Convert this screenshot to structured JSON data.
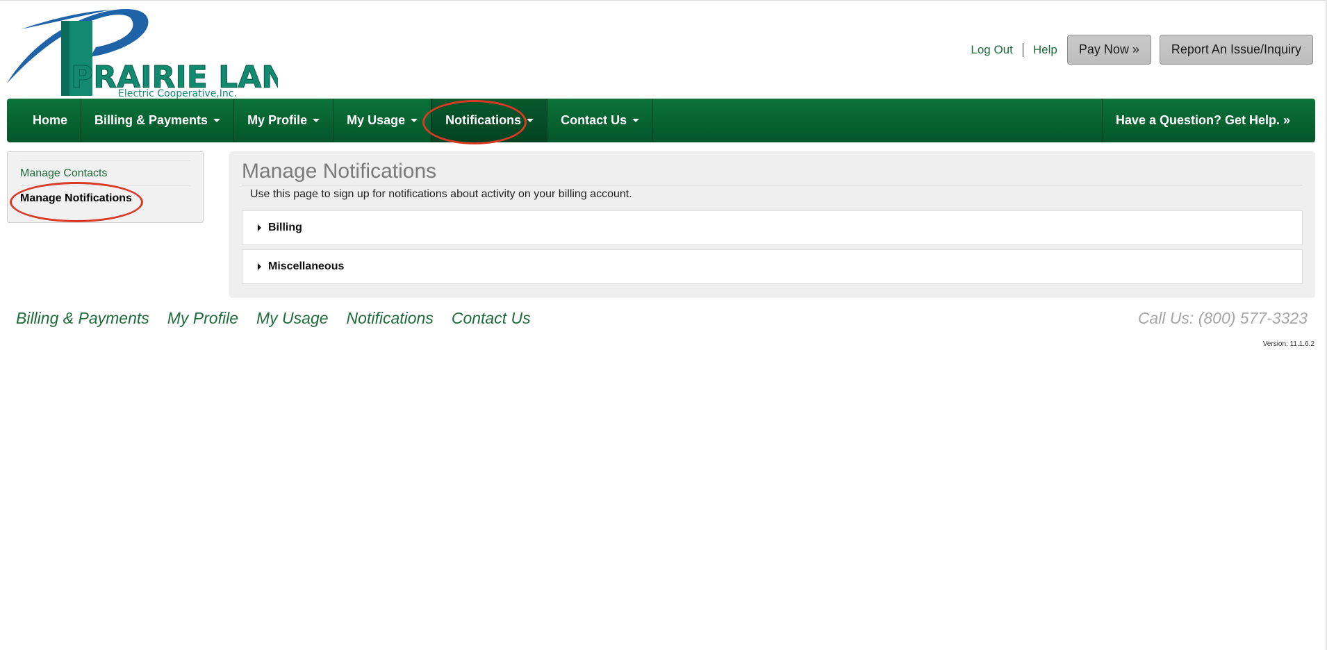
{
  "brand": {
    "name": "PRAIRIE LAND",
    "subtitle": "Electric Cooperative,Inc.",
    "colors": {
      "teal": "#118a6f",
      "blue": "#1e63a8"
    }
  },
  "header": {
    "logout_label": "Log Out",
    "help_label": "Help",
    "pay_now_label": "Pay Now »",
    "report_label": "Report An Issue/Inquiry"
  },
  "nav": {
    "home": "Home",
    "billing": "Billing & Payments",
    "profile": "My Profile",
    "usage": "My Usage",
    "notifications": "Notifications",
    "contact": "Contact Us",
    "help": "Have a Question? Get Help. »"
  },
  "sidebar": {
    "items": [
      {
        "label": "Manage Contacts"
      },
      {
        "label": "Manage Notifications"
      }
    ]
  },
  "main": {
    "title": "Manage Notifications",
    "description": "Use this page to sign up for notifications about activity on your billing account.",
    "sections": [
      {
        "label": "Billing"
      },
      {
        "label": "Miscellaneous"
      }
    ]
  },
  "footer": {
    "links": [
      "Billing & Payments",
      "My Profile",
      "My Usage",
      "Notifications",
      "Contact Us"
    ],
    "call_us": "Call Us: (800) 577-3323",
    "version": "Version: 11.1.6.2"
  },
  "colors": {
    "nav_green": "#0b7339",
    "link_green": "#1e6b3a",
    "annotation_red": "#d93a26"
  }
}
